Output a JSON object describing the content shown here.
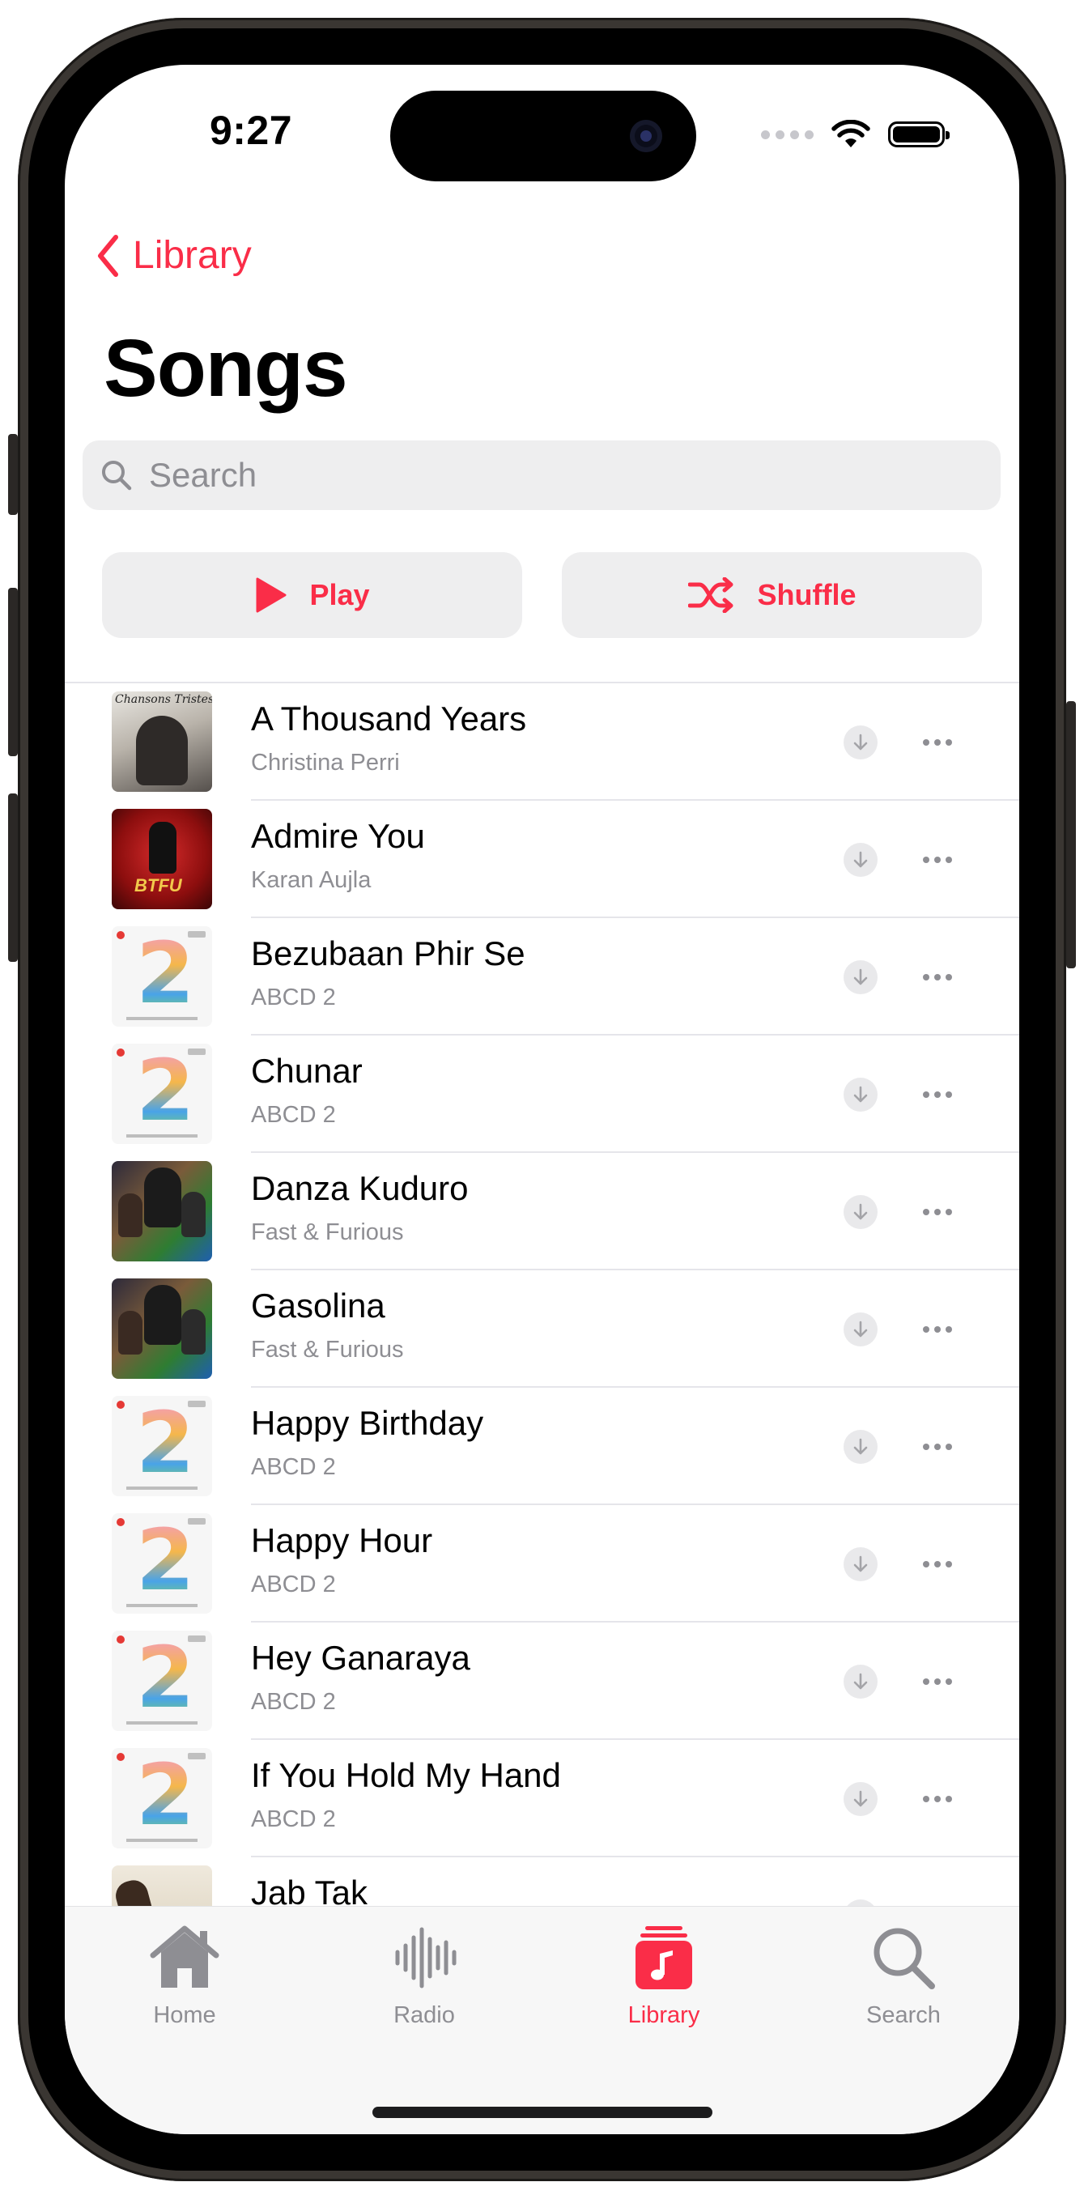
{
  "status_bar": {
    "time": "9:27"
  },
  "nav": {
    "back_label": "Library",
    "title": "Songs"
  },
  "search": {
    "placeholder": "Search"
  },
  "actions": {
    "play_label": "Play",
    "shuffle_label": "Shuffle"
  },
  "colors": {
    "accent": "#fa2d48",
    "secondary_text": "#8e8e93",
    "separator": "#e5e5ea"
  },
  "songs": [
    {
      "title": "A Thousand Years",
      "artist": "Christina Perri",
      "artwork_text": "Chansons Tristes"
    },
    {
      "title": "Admire You",
      "artist": "Karan Aujla",
      "artwork_text": "BTFU"
    },
    {
      "title": "Bezubaan Phir Se",
      "artist": "ABCD 2",
      "artwork_text": "2"
    },
    {
      "title": "Chunar",
      "artist": "ABCD 2",
      "artwork_text": "2"
    },
    {
      "title": "Danza Kuduro",
      "artist": "Fast & Furious"
    },
    {
      "title": "Gasolina",
      "artist": "Fast & Furious"
    },
    {
      "title": "Happy Birthday",
      "artist": "ABCD 2",
      "artwork_text": "2"
    },
    {
      "title": "Happy Hour",
      "artist": "ABCD 2",
      "artwork_text": "2"
    },
    {
      "title": "Hey Ganaraya",
      "artist": "ABCD 2",
      "artwork_text": "2"
    },
    {
      "title": "If You Hold My Hand",
      "artist": "ABCD 2",
      "artwork_text": "2"
    },
    {
      "title": "Jab Tak",
      "artist": ""
    }
  ],
  "tabbar": {
    "items": [
      {
        "label": "Home",
        "icon": "house-icon",
        "active": false
      },
      {
        "label": "Radio",
        "icon": "waveform-icon",
        "active": false
      },
      {
        "label": "Library",
        "icon": "music-library-icon",
        "active": true
      },
      {
        "label": "Search",
        "icon": "magnifier-icon",
        "active": false
      }
    ]
  }
}
